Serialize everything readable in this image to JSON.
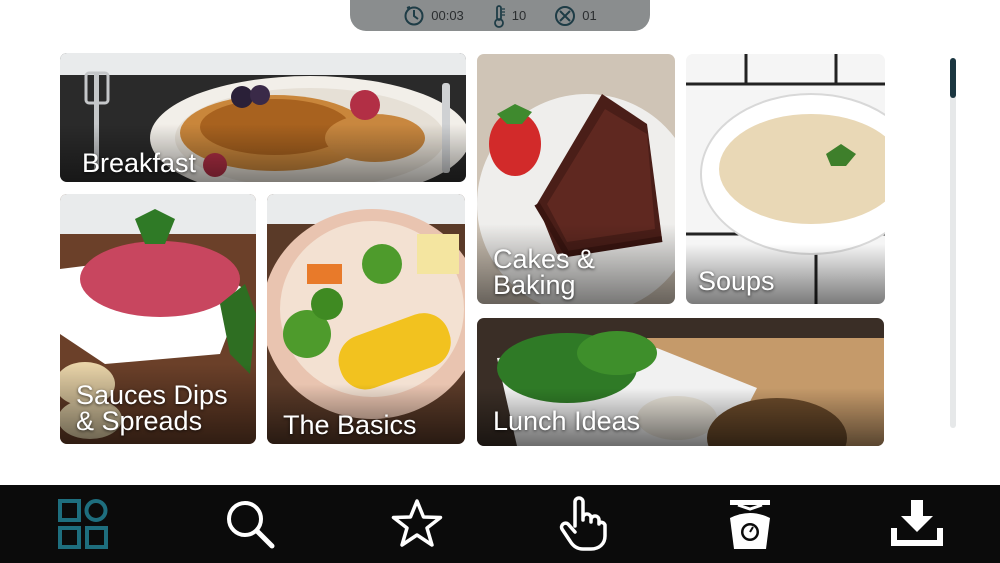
{
  "status": {
    "timer": "00:03",
    "temperature": "10",
    "speed": "01"
  },
  "categories": [
    {
      "label": "Breakfast"
    },
    {
      "label": "Cakes &\nBaking"
    },
    {
      "label": "Soups"
    },
    {
      "label": "Sauces Dips\n& Spreads"
    },
    {
      "label": "The Basics"
    },
    {
      "label": "Lunch Ideas"
    }
  ],
  "nav": [
    {
      "icon": "grid-icon",
      "active": true
    },
    {
      "icon": "search-icon"
    },
    {
      "icon": "star-icon"
    },
    {
      "icon": "hand-pointer-icon"
    },
    {
      "icon": "scale-icon"
    },
    {
      "icon": "download-icon"
    }
  ],
  "colors": {
    "accent": "#1e6e7e",
    "navbar": "#0b0b0b",
    "status_pill": "#8a8d8e"
  }
}
